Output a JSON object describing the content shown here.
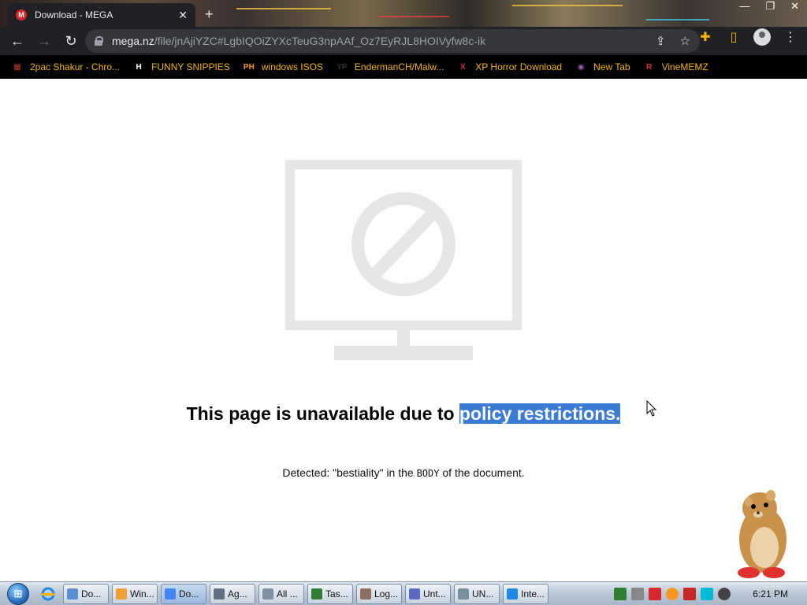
{
  "browser": {
    "tab": {
      "title": "Download - MEGA",
      "favicon": "mega-icon",
      "close": "✕"
    },
    "new_tab": "+",
    "window_controls": [
      "—",
      "❐",
      "✕"
    ],
    "url": {
      "host": "mega.nz",
      "path": "/file/jnAjiYZC#LgbIQOiZYXcTeuG3npAAf_Oz7EyRJL8HOIVyfw8c-ik"
    },
    "bookmarks": [
      {
        "label": "2pac Shakur - Chro...",
        "icon": "folder-icon",
        "color": "#c0392b",
        "glyph": "▦"
      },
      {
        "label": "FUNNY SNIPPIES",
        "icon": "h-icon",
        "color": "#ffffff",
        "glyph": "H"
      },
      {
        "label": "windows ISOS",
        "icon": "ph-icon",
        "color": "#f7971d",
        "glyph": "PH"
      },
      {
        "label": "EndermanCH/Malw...",
        "icon": "yp-icon",
        "color": "#333333",
        "glyph": "YP"
      },
      {
        "label": "XP Horror Download",
        "icon": "x-icon",
        "color": "#d9272e",
        "glyph": "X"
      },
      {
        "label": "New Tab",
        "icon": "globe-icon",
        "color": "#9b59b6",
        "glyph": "◉"
      },
      {
        "label": "VineMEMZ",
        "icon": "r-icon",
        "color": "#d9272e",
        "glyph": "R"
      }
    ]
  },
  "page": {
    "headline_prefix": "This page is unavailable due to ",
    "headline_selected": "policy restrictions.",
    "detected_prefix": "Detected: \"bestiality\" in the ",
    "detected_code": "BODY",
    "detected_suffix": " of the document."
  },
  "taskbar": {
    "start_glyph": "⊞",
    "buttons": [
      {
        "label": "Do...",
        "color": "#5a8fd0"
      },
      {
        "label": "Win...",
        "color": "#f0a030"
      },
      {
        "label": "Do...",
        "color": "#4285f4",
        "active": true
      },
      {
        "label": "Ag...",
        "color": "#607080"
      },
      {
        "label": "All ...",
        "color": "#8090a0"
      },
      {
        "label": "Tas...",
        "color": "#2e7d32"
      },
      {
        "label": "Log...",
        "color": "#8d6e63"
      },
      {
        "label": "Unt...",
        "color": "#5c6bc0"
      },
      {
        "label": "UN...",
        "color": "#78909c"
      },
      {
        "label": "Inte...",
        "color": "#1e88e5"
      }
    ],
    "clock": "6:21 PM"
  },
  "colors": {
    "selection": "#3a7bd5",
    "chrome_dark": "#202124",
    "bookmark_text": "#f4b400"
  }
}
